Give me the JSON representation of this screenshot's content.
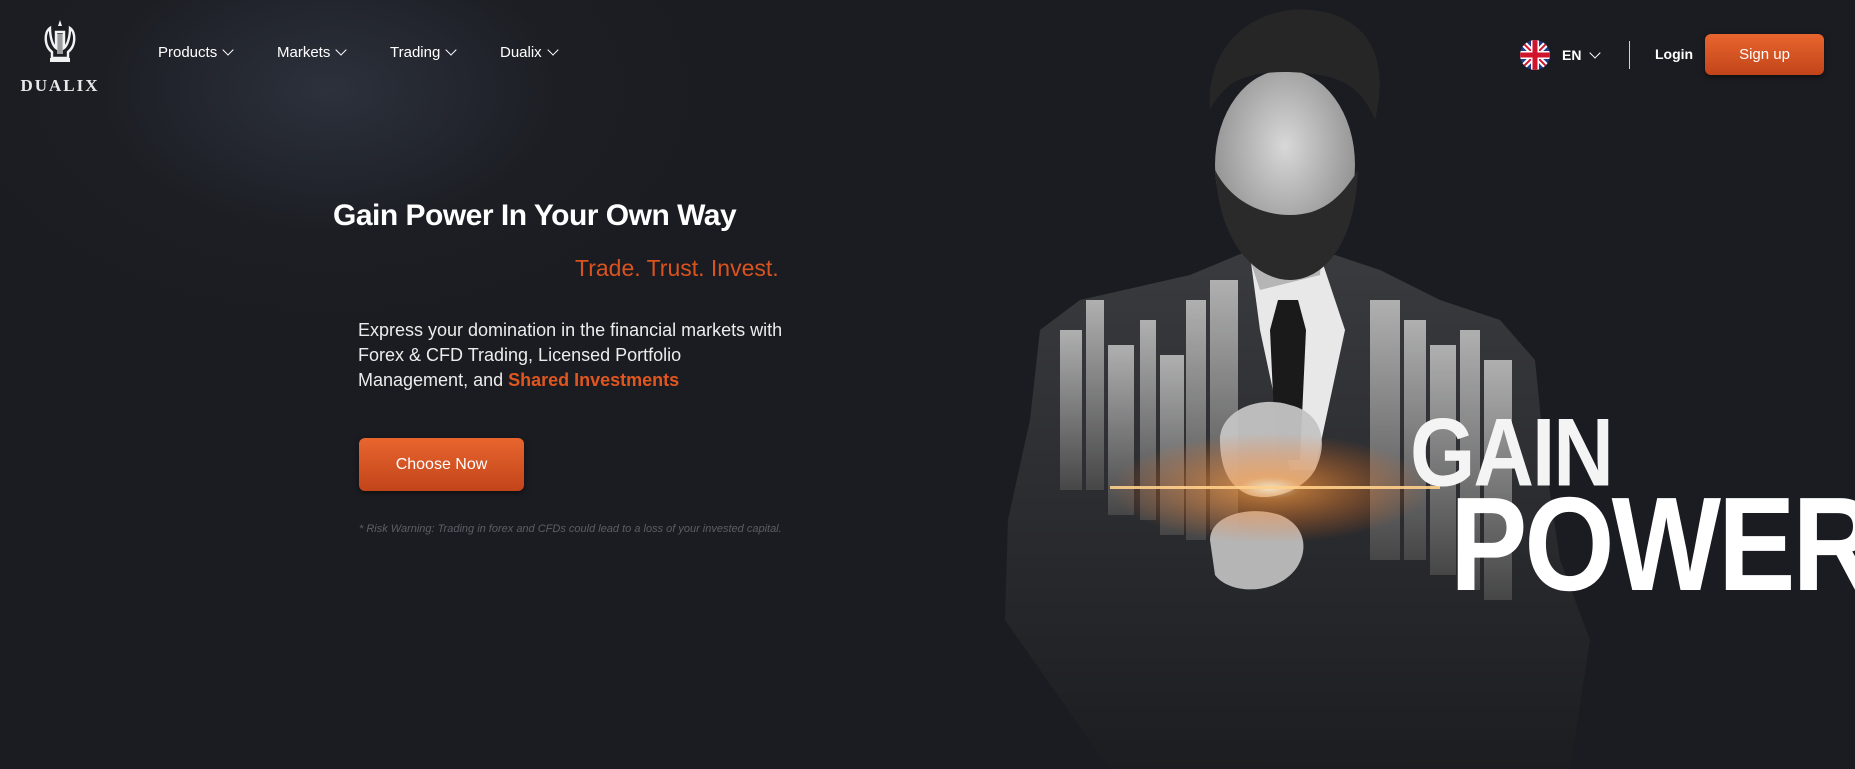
{
  "brand": {
    "name": "DUALIX"
  },
  "nav": {
    "items": [
      {
        "label": "Products"
      },
      {
        "label": "Markets"
      },
      {
        "label": "Trading"
      },
      {
        "label": "Dualix"
      }
    ]
  },
  "header": {
    "language": "EN",
    "login_label": "Login",
    "signup_label": "Sign up"
  },
  "hero": {
    "headline": "Gain Power In Your Own Way",
    "tagline": "Trade. Trust. Invest.",
    "description_prefix": "Express your domination in the financial markets with Forex & CFD Trading, Licensed Portfolio Management, and ",
    "description_highlight": "Shared Investments",
    "cta_label": "Choose Now",
    "risk_warning": "* Risk Warning: Trading in forex and CFDs could lead to a loss of your invested capital.",
    "art_line1": "GAIN",
    "art_line2": "POWER"
  },
  "icons": {
    "logo": "lyre-icon",
    "language_flag": "uk-flag-icon",
    "dropdown": "chevron-down-icon"
  },
  "colors": {
    "accent": "#d9531f",
    "button_top": "#e8652e",
    "button_bottom": "#c2441a",
    "background": "#1b1c21"
  }
}
